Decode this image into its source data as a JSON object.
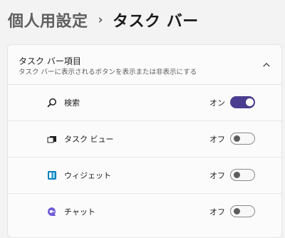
{
  "breadcrumb": {
    "parent": "個人用設定",
    "separator": "›",
    "current": "タスク バー"
  },
  "section": {
    "title": "タスク バー項目",
    "subtitle": "タスク バーに表示されるボタンを表示または非表示にする",
    "expanded": true,
    "collapse_icon": "chevron-up-icon"
  },
  "items": [
    {
      "label": "検索",
      "state": "オン",
      "on": true,
      "icon": "search-icon"
    },
    {
      "label": "タスク ビュー",
      "state": "オフ",
      "on": false,
      "icon": "task-view-icon"
    },
    {
      "label": "ウィジェット",
      "state": "オフ",
      "on": false,
      "icon": "widgets-icon"
    },
    {
      "label": "チャット",
      "state": "オフ",
      "on": false,
      "icon": "chat-icon"
    }
  ],
  "colors": {
    "accent": "#4a3d8f",
    "background": "#f3f3f3",
    "panel": "#fbfbfb"
  }
}
